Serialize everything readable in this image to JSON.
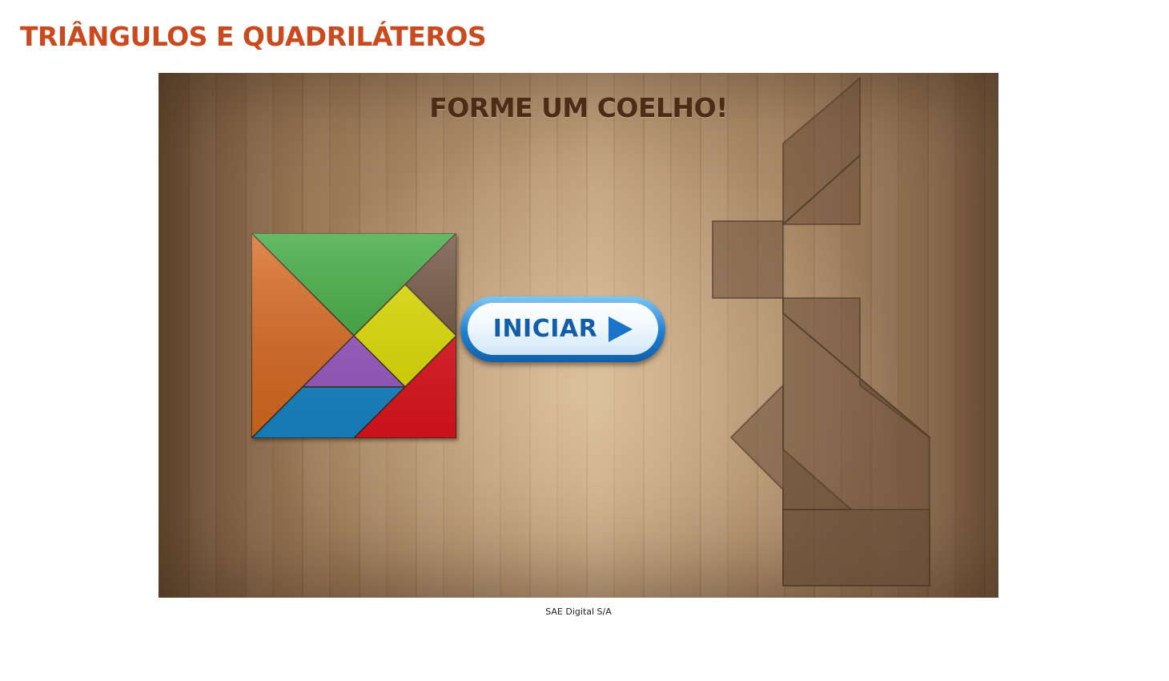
{
  "page": {
    "title": "TRIÂNGULOS E QUADRILÁTEROS",
    "credit": "SAE Digital S/A"
  },
  "game": {
    "heading": "FORME UM COELHO!",
    "start_button_label": "INICIAR",
    "start_button_icon": "play-arrow-icon",
    "tangram_pieces": [
      {
        "name": "large-triangle-green",
        "color": "#3aa63a"
      },
      {
        "name": "large-triangle-orange",
        "color": "#d9691f"
      },
      {
        "name": "small-triangle-brown",
        "color": "#6d4e3c"
      },
      {
        "name": "square-yellow",
        "color": "#dede00"
      },
      {
        "name": "small-triangle-purple",
        "color": "#9957c2"
      },
      {
        "name": "parallelogram-blue",
        "color": "#1786c8"
      },
      {
        "name": "medium-triangle-red",
        "color": "#e0141e"
      }
    ],
    "target_shape": "rabbit-silhouette"
  },
  "colors": {
    "title": "#c94a1f",
    "heading": "#4a2c17",
    "button_blue": "#1e7fd0"
  }
}
